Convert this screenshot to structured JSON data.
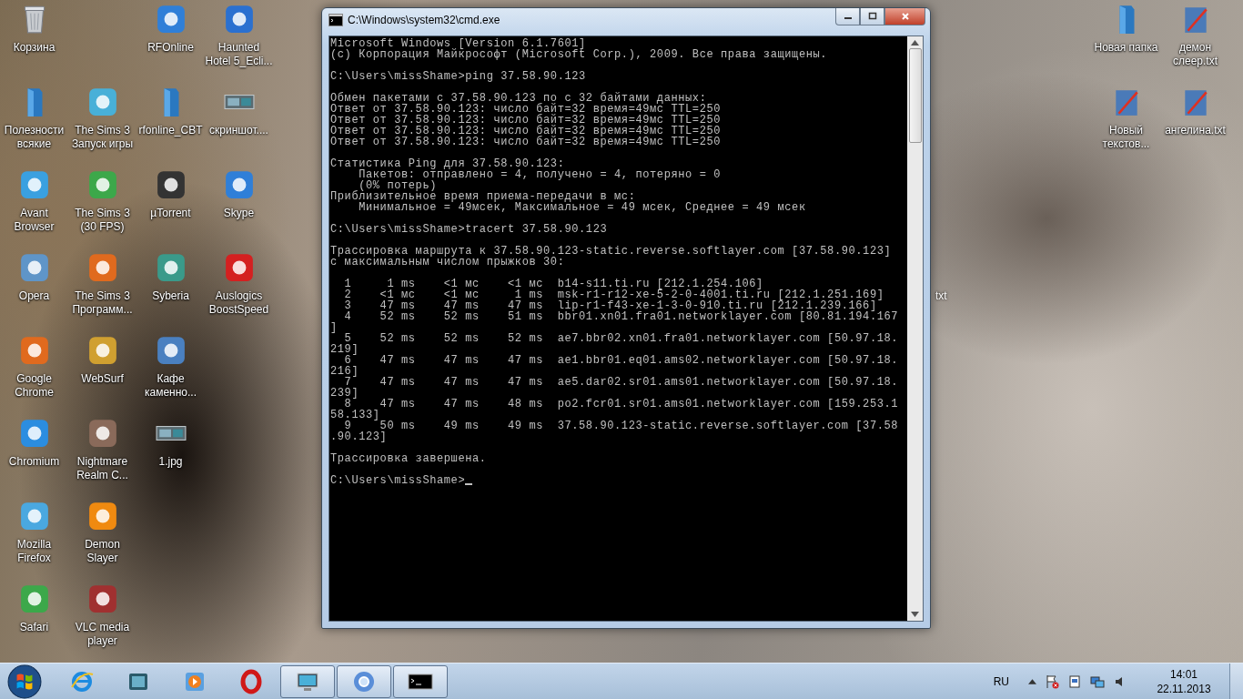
{
  "desktop_icons": [
    {
      "label": "Корзина",
      "kind": "bin"
    },
    {
      "label": "Полезности всякие",
      "kind": "folder"
    },
    {
      "label": "Avant Browser",
      "kind": "app"
    },
    {
      "label": "Opera",
      "kind": "app"
    },
    {
      "label": "Google Chrome",
      "kind": "app"
    },
    {
      "label": "Chromium",
      "kind": "app"
    },
    {
      "label": "Mozilla Firefox",
      "kind": "app"
    },
    {
      "label": "Safari",
      "kind": "app"
    },
    {
      "label": "The Sims 3 Запуск игры",
      "kind": "app"
    },
    {
      "label": "The Sims 3 (30 FPS)",
      "kind": "app"
    },
    {
      "label": "The Sims 3 Программ...",
      "kind": "app"
    },
    {
      "label": "WebSurf",
      "kind": "app"
    },
    {
      "label": "Nightmare Realm C...",
      "kind": "app"
    },
    {
      "label": "Demon Slayer",
      "kind": "app"
    },
    {
      "label": "VLC media player",
      "kind": "app"
    },
    {
      "label": "RFOnline",
      "kind": "app"
    },
    {
      "label": "rfonline_CBT",
      "kind": "folder"
    },
    {
      "label": "µTorrent",
      "kind": "app"
    },
    {
      "label": "Syberia",
      "kind": "app"
    },
    {
      "label": "Кафе каменно...",
      "kind": "app"
    },
    {
      "label": "1.jpg",
      "kind": "image"
    },
    {
      "label": "Haunted Hotel 5_Ecli...",
      "kind": "app"
    },
    {
      "label": "скриншот....",
      "kind": "image"
    },
    {
      "label": "Skype",
      "kind": "app"
    },
    {
      "label": "Auslogics BoostSpeed",
      "kind": "app"
    },
    {
      "label": "Новая папка",
      "kind": "folder"
    },
    {
      "label": "Новый текстов...",
      "kind": "txt"
    },
    {
      "label": "демон слеер.txt",
      "kind": "txt"
    },
    {
      "label": "ангелина.txt",
      "kind": "txt"
    }
  ],
  "hidden_icon_label_fragment": "txt",
  "window": {
    "title": "C:\\Windows\\system32\\cmd.exe",
    "console_blocks": [
      [
        "Microsoft Windows [Version 6.1.7601]",
        "(c) Корпорация Майкрософт (Microsoft Corp.), 2009. Все права защищены."
      ],
      [
        "C:\\Users\\missShame>ping 37.58.90.123"
      ],
      [
        "Обмен пакетами с 37.58.90.123 по с 32 байтами данных:",
        "Ответ от 37.58.90.123: число байт=32 время=49мс TTL=250",
        "Ответ от 37.58.90.123: число байт=32 время=49мс TTL=250",
        "Ответ от 37.58.90.123: число байт=32 время=49мс TTL=250",
        "Ответ от 37.58.90.123: число байт=32 время=49мс TTL=250"
      ],
      [
        "Статистика Ping для 37.58.90.123:",
        "    Пакетов: отправлено = 4, получено = 4, потеряно = 0",
        "    (0% потерь)",
        "Приблизительное время приема-передачи в мс:",
        "    Минимальное = 49мсек, Максимальное = 49 мсек, Среднее = 49 мсек"
      ],
      [
        "C:\\Users\\missShame>tracert 37.58.90.123"
      ],
      [
        "Трассировка маршрута к 37.58.90.123-static.reverse.softlayer.com [37.58.90.123]",
        "с максимальным числом прыжков 30:"
      ],
      [
        "  1     1 ms    <1 мс    <1 мс  b14-s11.ti.ru [212.1.254.106]",
        "  2    <1 мс    <1 мс     1 ms  msk-r1-r12-xe-5-2-0-4001.ti.ru [212.1.251.169]",
        "  3    47 ms    47 ms    47 ms  lip-r1-f43-xe-1-3-0-910.ti.ru [212.1.239.166]",
        "  4    52 ms    52 ms    51 ms  bbr01.xn01.fra01.networklayer.com [80.81.194.167",
        "]",
        "  5    52 ms    52 ms    52 ms  ae7.bbr02.xn01.fra01.networklayer.com [50.97.18.",
        "219]",
        "  6    47 ms    47 ms    47 ms  ae1.bbr01.eq01.ams02.networklayer.com [50.97.18.",
        "216]",
        "  7    47 ms    47 ms    47 ms  ae5.dar02.sr01.ams01.networklayer.com [50.97.18.",
        "239]",
        "  8    47 ms    47 ms    48 ms  po2.fcr01.sr01.ams01.networklayer.com [159.253.1",
        "58.133]",
        "  9    50 ms    49 ms    49 ms  37.58.90.123-static.reverse.softlayer.com [37.58",
        ".90.123]"
      ],
      [
        "Трассировка завершена."
      ]
    ],
    "prompt": "C:\\Users\\missShame>"
  },
  "taskbar": {
    "items": [
      {
        "kind": "ie",
        "running": false
      },
      {
        "kind": "film",
        "running": false
      },
      {
        "kind": "media",
        "running": false
      },
      {
        "kind": "opera",
        "running": false
      },
      {
        "kind": "monitor",
        "running": true
      },
      {
        "kind": "chromium",
        "running": true
      },
      {
        "kind": "console",
        "running": true
      }
    ],
    "language": "RU",
    "time": "14:01",
    "date": "22.11.2013"
  }
}
